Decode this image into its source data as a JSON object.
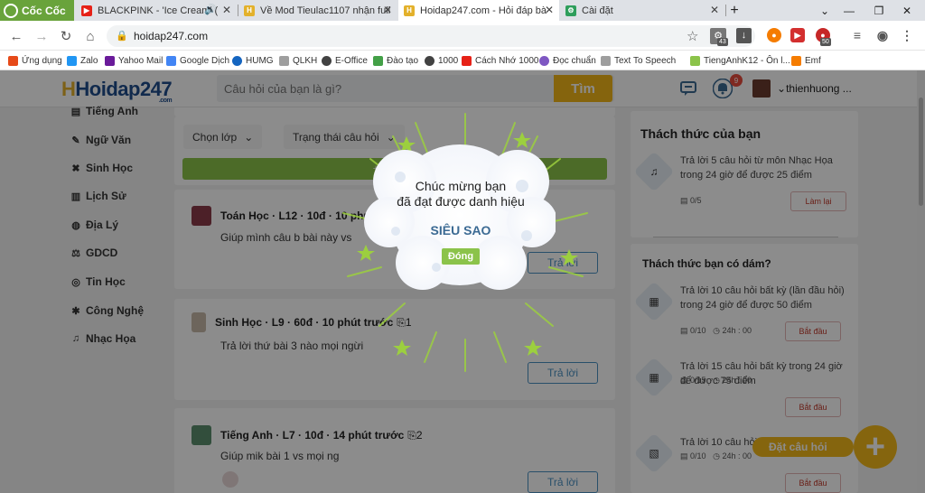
{
  "browser": {
    "brand": "Cốc Cốc",
    "tabs": [
      {
        "title": "BLACKPINK - 'Ice Cream' (",
        "icon": "youtube-icon",
        "color": "#e62117"
      },
      {
        "title": "Về Mod Tieulac1107 nhận full",
        "icon": "hoidap-icon",
        "color": "#e3b12b"
      },
      {
        "title": "Hoidap247.com - Hỏi đáp bà",
        "icon": "hoidap-icon",
        "color": "#e3b12b"
      },
      {
        "title": "Cài đặt",
        "icon": "settings-icon",
        "color": "#2e9e5b"
      }
    ],
    "url": "hoidap247.com",
    "extension_badges": [
      "43",
      "50"
    ],
    "bookmarks": [
      {
        "label": "Ứng dụng",
        "color": "#e64a19"
      },
      {
        "label": "Zalo",
        "color": "#2196f3"
      },
      {
        "label": "Yahoo Mail",
        "color": "#6a1b9a"
      },
      {
        "label": "Google Dịch",
        "color": "#4285f4"
      },
      {
        "label": "HUMG",
        "color": "#1565c0"
      },
      {
        "label": "QLKH",
        "color": "#9e9e9e"
      },
      {
        "label": "E-Office",
        "color": "#424242"
      },
      {
        "label": "Đào tạo",
        "color": "#43a047"
      },
      {
        "label": "1000",
        "color": "#424242"
      },
      {
        "label": "Cách Nhớ 1000",
        "color": "#e62117"
      },
      {
        "label": "Đọc chuẩn",
        "color": "#7e57c2"
      },
      {
        "label": "Text To Speech",
        "color": "#9e9e9e"
      },
      {
        "label": "TiengAnhK12 - Ôn l...",
        "color": "#8bc34a"
      },
      {
        "label": "Emf",
        "color": "#f57c00"
      }
    ]
  },
  "site": {
    "logo": "Hoidap247",
    "logo_sub": ".com",
    "search_placeholder": "Câu hỏi của bạn là gì?",
    "search_button": "Tìm",
    "notification_count": "9",
    "username": "thienhuong ..."
  },
  "sidebar": {
    "items": [
      {
        "label": "Tiếng Anh",
        "icon": "book-icon"
      },
      {
        "label": "Ngữ Văn",
        "icon": "pen-icon"
      },
      {
        "label": "Sinh Học",
        "icon": "dna-icon"
      },
      {
        "label": "Lịch Sử",
        "icon": "scroll-icon"
      },
      {
        "label": "Địa Lý",
        "icon": "globe-icon"
      },
      {
        "label": "GDCD",
        "icon": "scales-icon"
      },
      {
        "label": "Tin Học",
        "icon": "computer-icon"
      },
      {
        "label": "Công Nghệ",
        "icon": "gear-icon"
      },
      {
        "label": "Nhạc Họa",
        "icon": "music-icon"
      }
    ]
  },
  "main": {
    "filter_class": "Chọn lớp",
    "filter_status": "Trạng thái câu hỏi",
    "banner": "+40 câu h",
    "questions": [
      {
        "subject": "Toán Học",
        "grade": "L12",
        "points": "10đ",
        "time": "10 phú",
        "text": "Giúp mình câu b bài này vs",
        "attachments": "",
        "answer_label": "Trả lời"
      },
      {
        "subject": "Sinh Học",
        "grade": "L9",
        "points": "60đ",
        "time": "10 phút trước",
        "text": "Trả lời thứ bài 3 nào mọi ngừi",
        "attachments": "1",
        "answer_label": "Trả lời"
      },
      {
        "subject": "Tiếng Anh",
        "grade": "L7",
        "points": "10đ",
        "time": "14 phút trước",
        "text": "Giúp mik bài 1 vs mọi ng",
        "attachments": "2",
        "answer_label": "Trả lời"
      }
    ]
  },
  "right": {
    "your_challenge_title": "Thách thức của bạn",
    "your_challenge": {
      "text": "Trả lời 5 câu hỏi  từ môn Nhạc Họa trong 24 giờ để được 25 điểm",
      "progress": "0/5",
      "button": "Làm lại"
    },
    "dare_title": "Thách thức bạn có dám?",
    "dares": [
      {
        "text": "Trả lời 10 câu hỏi  bất kỳ (lần đầu hỏi) trong 24 giờ để được 50 điểm",
        "progress": "0/10",
        "time": "24h : 00",
        "button": "Bắt đầu"
      },
      {
        "text": "Trả lời 15 câu hỏi  bất kỳ  trong 24 giờ để được 75 điểm",
        "progress": "0/15",
        "time": "24h : 00",
        "button": "Bắt đầu"
      },
      {
        "text": "Trả lời 10 câu hỏi",
        "progress": "0/10",
        "time": "24h : 00",
        "button": "Bắt đầu"
      }
    ]
  },
  "modal": {
    "line1": "Chúc mừng bạn",
    "line2": "đã đạt được danh hiệu",
    "rank": "SIÊU SAO",
    "close": "Đóng"
  },
  "ask_button": "Đặt câu hỏi"
}
